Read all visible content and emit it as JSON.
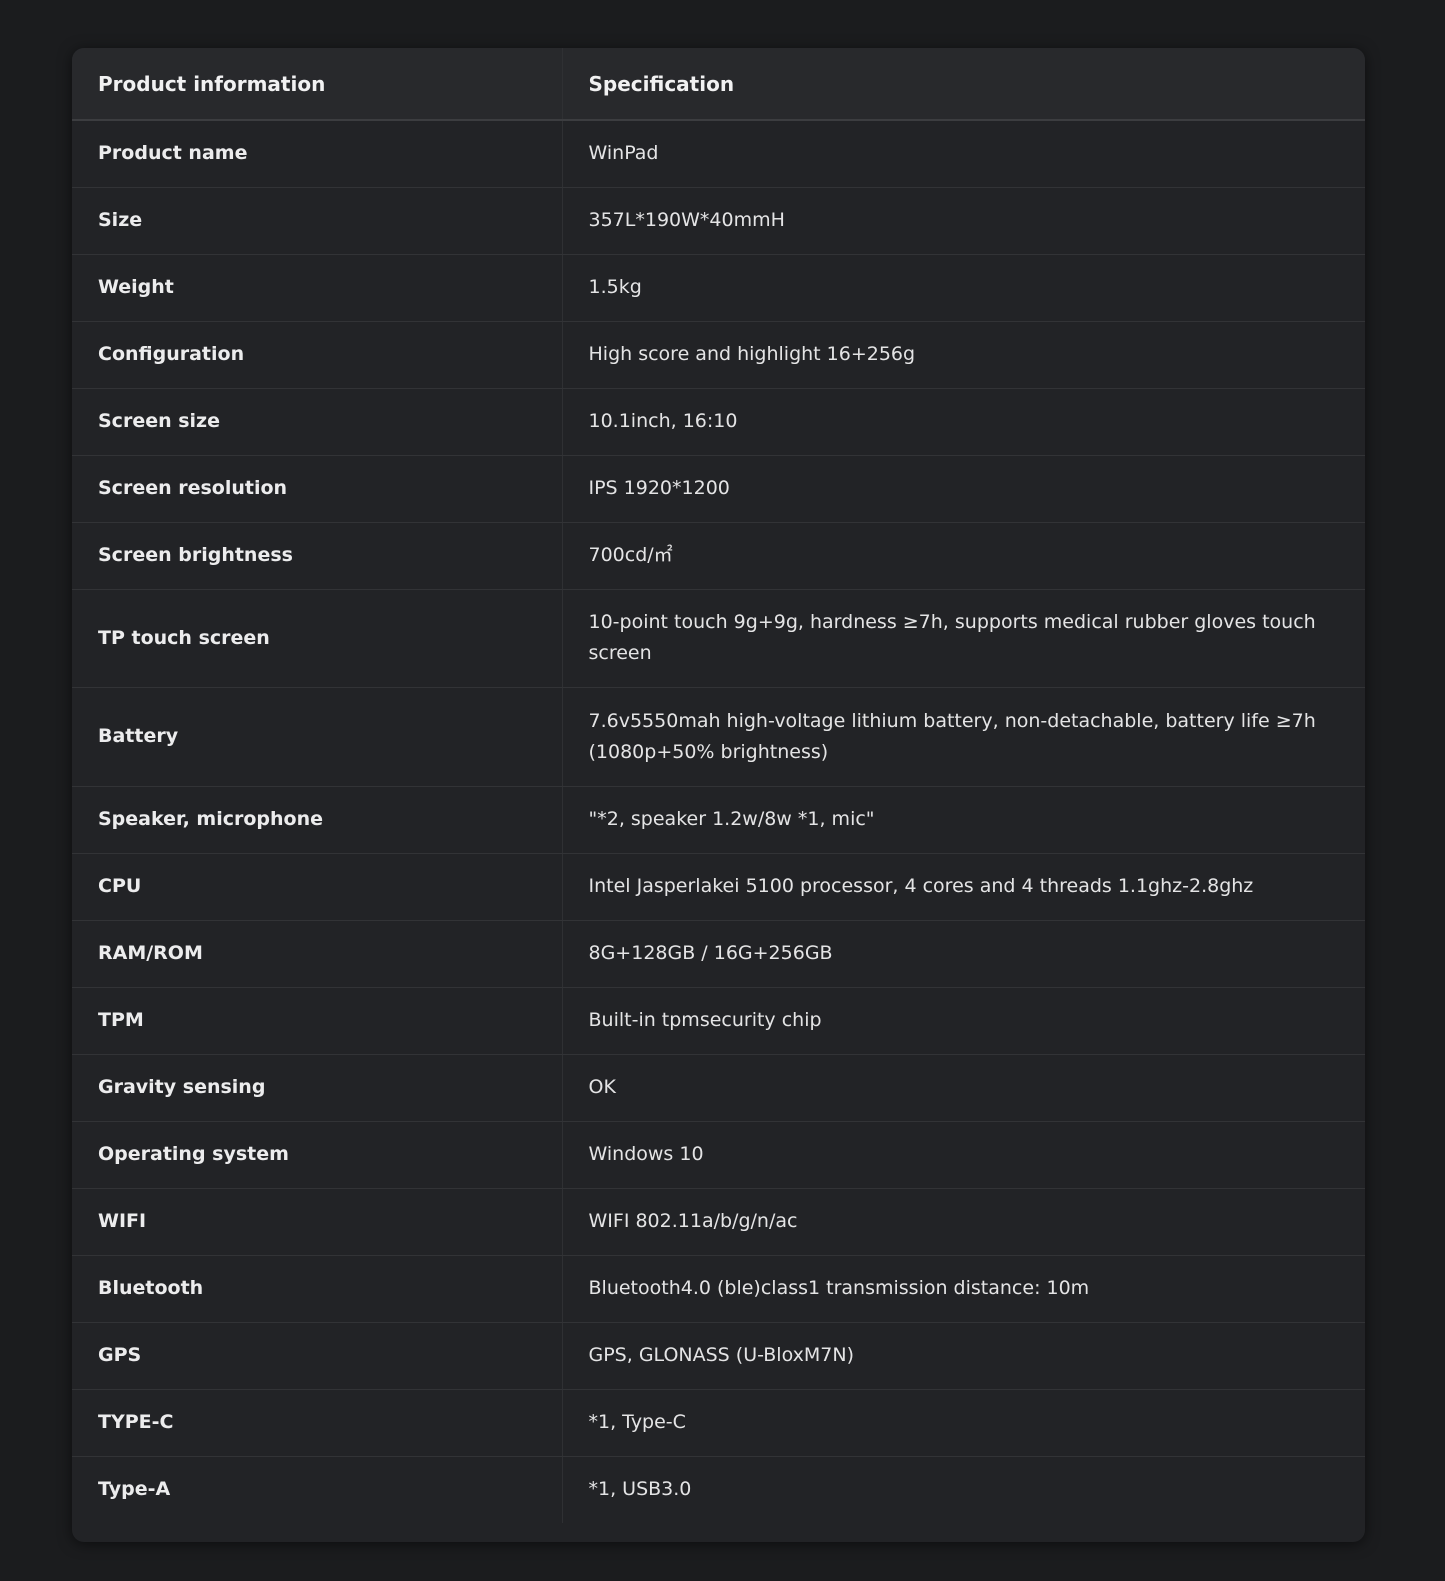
{
  "table": {
    "headers": [
      "Product information",
      "Specification"
    ],
    "rows": [
      [
        "Product name",
        "WinPad"
      ],
      [
        "Size",
        "357L*190W*40mmH"
      ],
      [
        "Weight",
        "1.5kg"
      ],
      [
        "Configuration",
        "High score and highlight 16+256g"
      ],
      [
        "Screen size",
        "10.1inch, 16:10"
      ],
      [
        "Screen resolution",
        "IPS 1920*1200"
      ],
      [
        "Screen brightness",
        "700cd/㎡"
      ],
      [
        "TP touch screen",
        "10-point touch 9g+9g, hardness ≥7h, supports medical rubber gloves touch screen"
      ],
      [
        "Battery",
        "7.6v5550mah high-voltage lithium battery, non-detachable, battery life ≥7h (1080p+50% brightness)"
      ],
      [
        "Speaker, microphone",
        "\"*2, speaker 1.2w/8w *1, mic\""
      ],
      [
        "CPU",
        "Intel Jasperlakei 5100 processor, 4 cores and 4 threads 1.1ghz-2.8ghz"
      ],
      [
        "RAM/ROM",
        "8G+128GB / 16G+256GB"
      ],
      [
        "TPM",
        "Built-in tpmsecurity chip"
      ],
      [
        "Gravity sensing",
        "OK"
      ],
      [
        "Operating system",
        "Windows 10"
      ],
      [
        "WIFI",
        "WIFI 802.11a/b/g/n/ac"
      ],
      [
        "Bluetooth",
        "Bluetooth4.0 (ble)class1 transmission distance: 10m"
      ],
      [
        "GPS",
        "GPS, GLONASS (U-BloxM7N)"
      ],
      [
        "TYPE-C",
        "*1, Type-C"
      ],
      [
        "Type-A",
        "*1, USB3.0"
      ]
    ]
  }
}
